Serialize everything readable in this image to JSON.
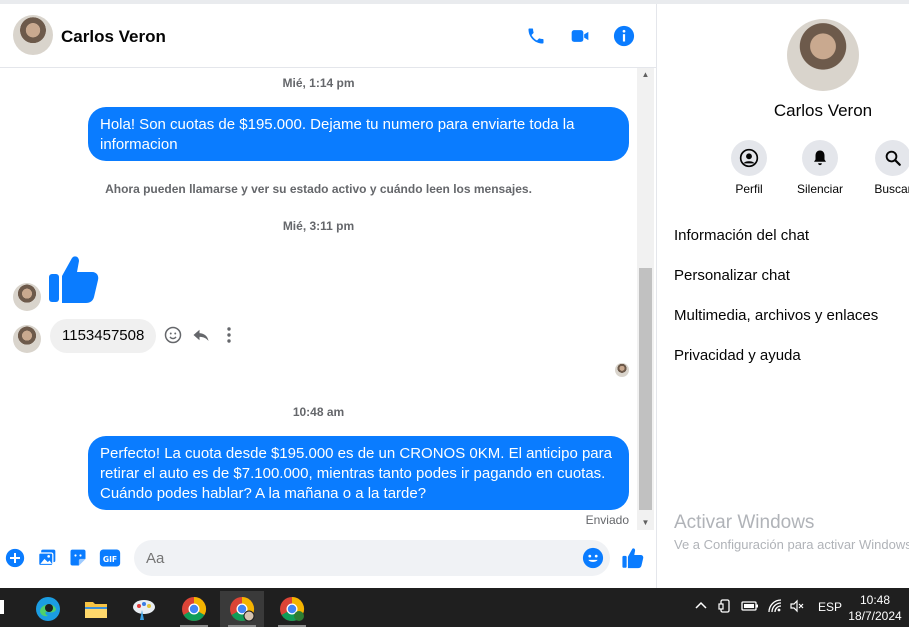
{
  "contact": {
    "name": "Carlos Veron"
  },
  "header": {
    "phone_icon": "phone-icon",
    "video_icon": "video-icon",
    "info_icon": "info-icon"
  },
  "messages": [
    {
      "type": "time",
      "text": "Mié, 1:14 pm"
    },
    {
      "type": "outgoing",
      "text": "Hola! Son cuotas de $195.000. Dejame tu numero para enviarte toda la informacion"
    },
    {
      "type": "system",
      "text": "Ahora pueden llamarse y ver su estado activo y cuándo leen los mensajes."
    },
    {
      "type": "time",
      "text": "Mié, 3:11 pm"
    },
    {
      "type": "incoming_like",
      "icon": "thumbs-up-icon"
    },
    {
      "type": "incoming",
      "text": "1153457508"
    },
    {
      "type": "time",
      "text": "10:48 am"
    },
    {
      "type": "outgoing",
      "text": "Perfecto! La cuota desde $195.000 es de un CRONOS 0KM. El anticipo para retirar el auto es de $7.100.000, mientras tanto podes ir pagando en cuotas. Cuándo podes hablar? A la mañana o a la tarde?"
    }
  ],
  "sent_status": "Enviado",
  "composer": {
    "placeholder": "Aa"
  },
  "right_panel": {
    "name": "Carlos Veron",
    "actions": [
      {
        "label": "Perfil",
        "icon": "profile-icon"
      },
      {
        "label": "Silenciar",
        "icon": "bell-icon"
      },
      {
        "label": "Buscar",
        "icon": "search-icon"
      }
    ],
    "menu": [
      "Información del chat",
      "Personalizar chat",
      "Multimedia, archivos y enlaces",
      "Privacidad y ayuda"
    ],
    "activate_title": "Activar Windows",
    "activate_sub": "Ve a Configuración para activar Windows."
  },
  "taskbar": {
    "language": "ESP",
    "time": "10:48",
    "date": "18/7/2024"
  },
  "colors": {
    "accent": "#0a7cff",
    "bubble_in": "#f0f0f0"
  }
}
